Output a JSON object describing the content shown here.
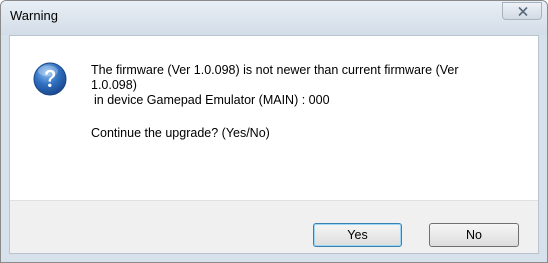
{
  "window": {
    "title": "Warning",
    "close_icon": "close-icon"
  },
  "message": {
    "icon": "question-icon",
    "line1": "The firmware (Ver 1.0.098) is not newer than current firmware (Ver",
    "line2": "1.0.098)",
    "line3": "in device Gamepad Emulator (MAIN) : 000",
    "prompt": "Continue the upgrade? (Yes/No)"
  },
  "buttons": {
    "yes_label": "Yes",
    "no_label": "No"
  },
  "colors": {
    "titlebar": "#d6e1ec",
    "icon_blue": "#2f6fc0",
    "default_button_border": "#3c7fb1"
  }
}
